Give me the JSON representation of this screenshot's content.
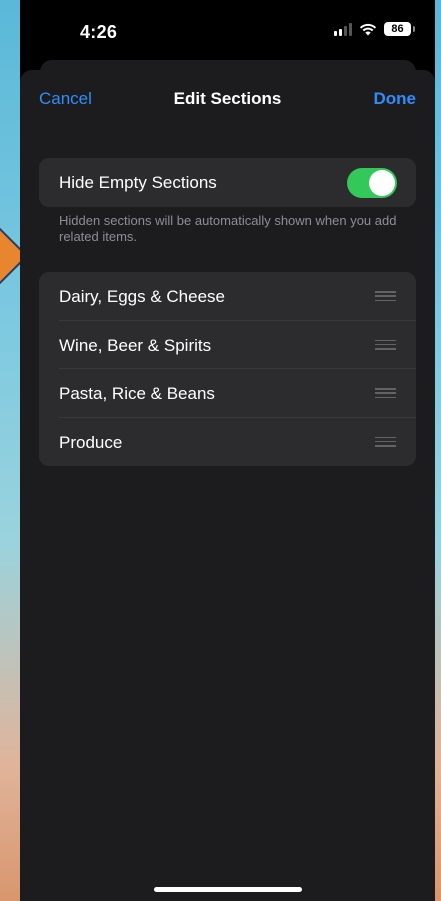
{
  "status_bar": {
    "time": "4:26",
    "battery": "86",
    "icons": [
      "signal-icon",
      "wifi-icon",
      "battery-icon"
    ]
  },
  "nav": {
    "cancel_label": "Cancel",
    "title": "Edit Sections",
    "done_label": "Done"
  },
  "hide_empty": {
    "label": "Hide Empty Sections",
    "enabled": true,
    "footnote": "Hidden sections will be automatically shown when you add related items."
  },
  "sections": [
    {
      "label": "Dairy, Eggs & Cheese"
    },
    {
      "label": "Wine, Beer & Spirits"
    },
    {
      "label": "Pasta, Rice & Beans"
    },
    {
      "label": "Produce"
    }
  ],
  "colors": {
    "accent": "#2f8dfb",
    "toggle_on": "#34c759",
    "sheet_bg": "#1c1c1e",
    "cell_bg": "#2c2c2e"
  }
}
